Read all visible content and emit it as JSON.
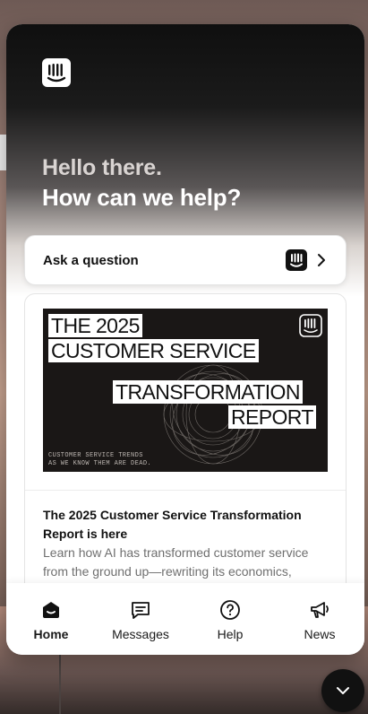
{
  "greeting": {
    "line1": "Hello there.",
    "line2": "How can we help?"
  },
  "ask": {
    "label": "Ask a question"
  },
  "news_card": {
    "banner": {
      "line1": "THE 2025",
      "line2": "CUSTOMER SERVICE",
      "line3": "TRANSFORMATION",
      "line4": "REPORT",
      "fine1": "CUSTOMER SERVICE TRENDS",
      "fine2": "AS WE KNOW THEM ARE DEAD."
    },
    "title": "The 2025 Customer Service Transformation Report is here",
    "body": "Learn how AI has transformed customer service from the ground up—rewriting its economics,"
  },
  "tabs": [
    {
      "label": "Home",
      "icon": "home-icon",
      "active": true
    },
    {
      "label": "Messages",
      "icon": "messages-icon",
      "active": false
    },
    {
      "label": "Help",
      "icon": "help-icon",
      "active": false
    },
    {
      "label": "News",
      "icon": "megaphone-icon",
      "active": false
    }
  ],
  "close_button": {
    "icon": "chevron-down-icon"
  },
  "colors": {
    "accent": "#111111",
    "header_top": "#0f0f0f",
    "muted_text": "#6f6f6f"
  }
}
